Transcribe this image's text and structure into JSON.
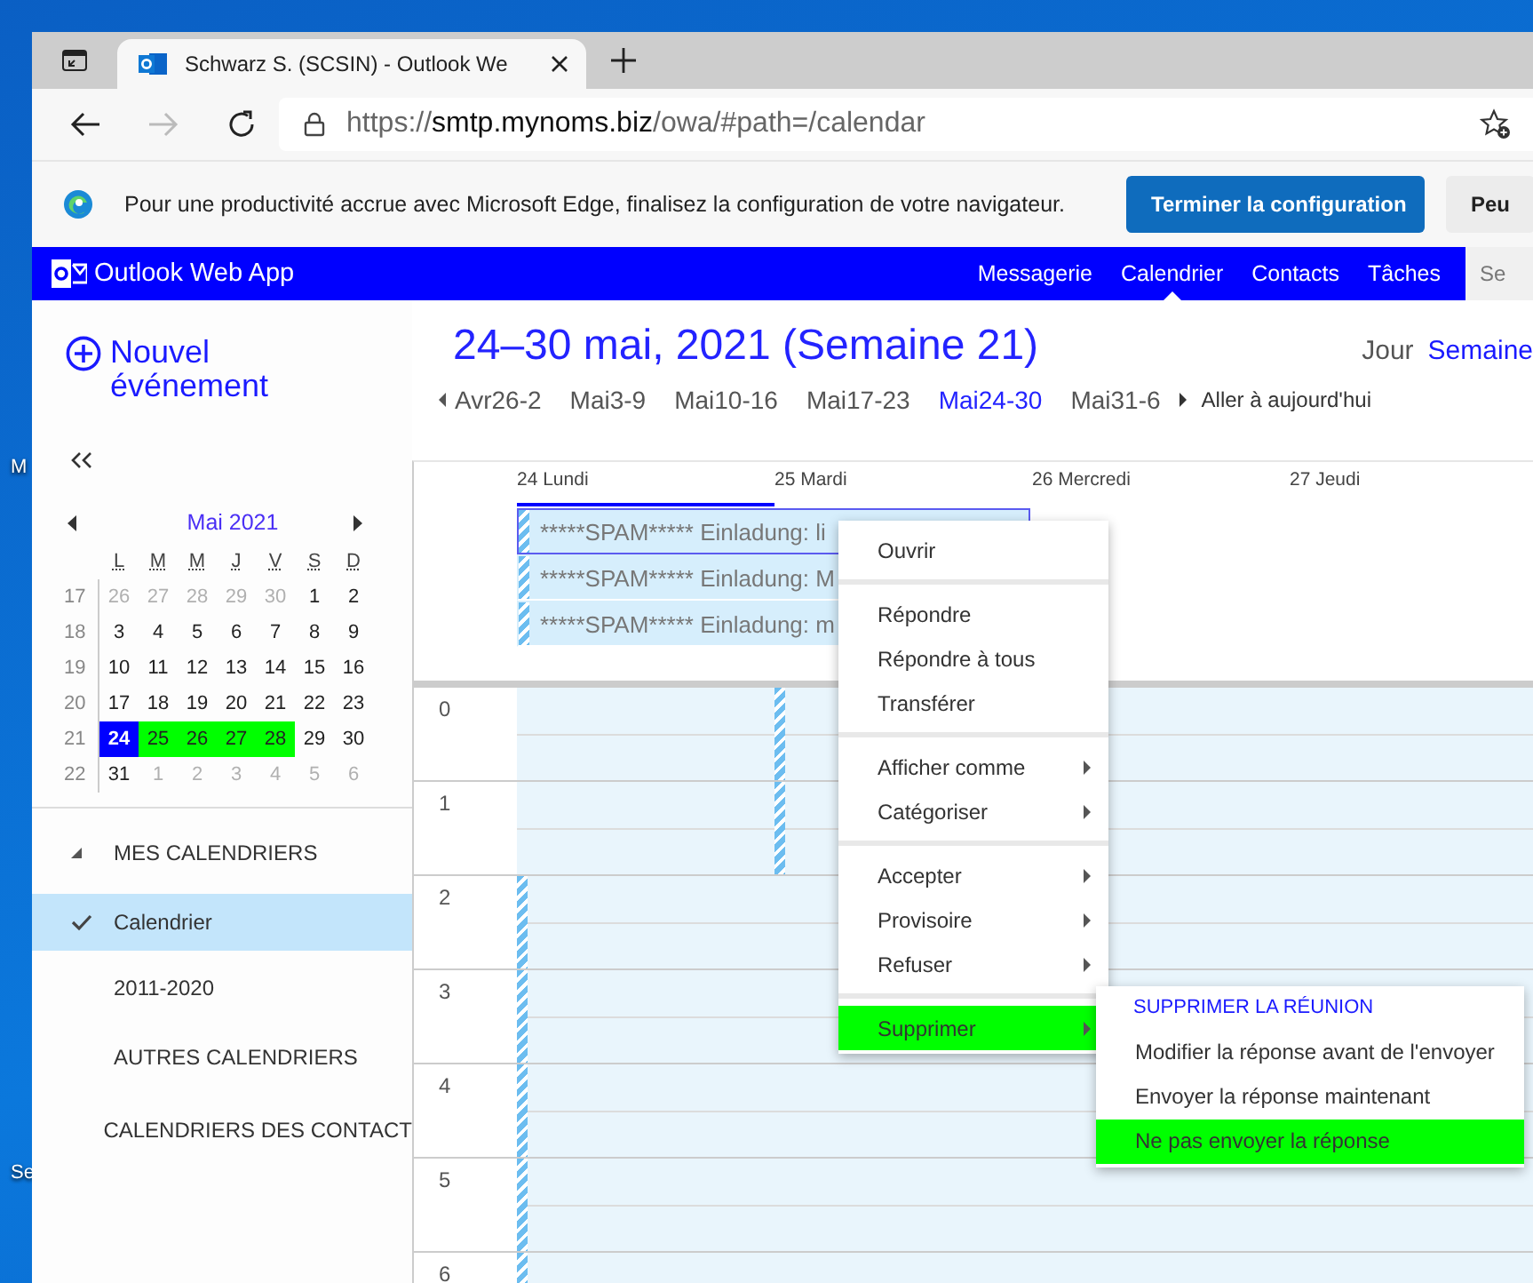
{
  "desktop": {
    "labels": [
      "M",
      "Se"
    ]
  },
  "browser": {
    "tabs": [
      {
        "title": "Schwarz S. (SCSIN) - Outlook We",
        "selected": true
      }
    ],
    "url": {
      "scheme": "https://",
      "host": "smtp.mynoms.biz",
      "path": "/owa/#path=/calendar"
    },
    "infobar": {
      "message": "Pour une productivité accrue avec Microsoft Edge, finalisez la configuration de votre navigateur.",
      "buttons": [
        {
          "label": "Terminer la configuration",
          "kind": "primary"
        },
        {
          "label": "Peu",
          "kind": "secondary"
        }
      ]
    }
  },
  "app": {
    "title": "Outlook Web App",
    "nav": [
      {
        "label": "Messagerie",
        "selected": false
      },
      {
        "label": "Calendrier",
        "selected": true
      },
      {
        "label": "Contacts",
        "selected": false
      },
      {
        "label": "Tâches",
        "selected": false
      }
    ],
    "search": {
      "placeholder": "Se"
    }
  },
  "sidebar": {
    "new_event": "Nouvel événement",
    "mini_calendar": {
      "month": "Mai 2021",
      "weekdays": [
        "L",
        "M",
        "M",
        "J",
        "V",
        "S",
        "D"
      ],
      "weeks": [
        {
          "number": "17",
          "days": [
            {
              "label": "26",
              "outside": true,
              "selected": false,
              "in_week": false
            },
            {
              "label": "27",
              "outside": true,
              "selected": false,
              "in_week": false
            },
            {
              "label": "28",
              "outside": true,
              "selected": false,
              "in_week": false
            },
            {
              "label": "29",
              "outside": true,
              "selected": false,
              "in_week": false
            },
            {
              "label": "30",
              "outside": true,
              "selected": false,
              "in_week": false
            },
            {
              "label": "1",
              "outside": false,
              "selected": false,
              "in_week": false
            },
            {
              "label": "2",
              "outside": false,
              "selected": false,
              "in_week": false
            }
          ]
        },
        {
          "number": "18",
          "days": [
            {
              "label": "3",
              "outside": false,
              "selected": false,
              "in_week": false
            },
            {
              "label": "4",
              "outside": false,
              "selected": false,
              "in_week": false
            },
            {
              "label": "5",
              "outside": false,
              "selected": false,
              "in_week": false
            },
            {
              "label": "6",
              "outside": false,
              "selected": false,
              "in_week": false
            },
            {
              "label": "7",
              "outside": false,
              "selected": false,
              "in_week": false
            },
            {
              "label": "8",
              "outside": false,
              "selected": false,
              "in_week": false
            },
            {
              "label": "9",
              "outside": false,
              "selected": false,
              "in_week": false
            }
          ]
        },
        {
          "number": "19",
          "days": [
            {
              "label": "10",
              "outside": false,
              "selected": false,
              "in_week": false
            },
            {
              "label": "11",
              "outside": false,
              "selected": false,
              "in_week": false
            },
            {
              "label": "12",
              "outside": false,
              "selected": false,
              "in_week": false
            },
            {
              "label": "13",
              "outside": false,
              "selected": false,
              "in_week": false
            },
            {
              "label": "14",
              "outside": false,
              "selected": false,
              "in_week": false
            },
            {
              "label": "15",
              "outside": false,
              "selected": false,
              "in_week": false
            },
            {
              "label": "16",
              "outside": false,
              "selected": false,
              "in_week": false
            }
          ]
        },
        {
          "number": "20",
          "days": [
            {
              "label": "17",
              "outside": false,
              "selected": false,
              "in_week": false
            },
            {
              "label": "18",
              "outside": false,
              "selected": false,
              "in_week": false
            },
            {
              "label": "19",
              "outside": false,
              "selected": false,
              "in_week": false
            },
            {
              "label": "20",
              "outside": false,
              "selected": false,
              "in_week": false
            },
            {
              "label": "21",
              "outside": false,
              "selected": false,
              "in_week": false
            },
            {
              "label": "22",
              "outside": false,
              "selected": false,
              "in_week": false
            },
            {
              "label": "23",
              "outside": false,
              "selected": false,
              "in_week": false
            }
          ]
        },
        {
          "number": "21",
          "days": [
            {
              "label": "24",
              "outside": false,
              "selected": true,
              "in_week": true
            },
            {
              "label": "25",
              "outside": false,
              "selected": false,
              "in_week": true
            },
            {
              "label": "26",
              "outside": false,
              "selected": false,
              "in_week": true
            },
            {
              "label": "27",
              "outside": false,
              "selected": false,
              "in_week": true
            },
            {
              "label": "28",
              "outside": false,
              "selected": false,
              "in_week": true
            },
            {
              "label": "29",
              "outside": false,
              "selected": false,
              "in_week": false
            },
            {
              "label": "30",
              "outside": false,
              "selected": false,
              "in_week": false
            }
          ]
        },
        {
          "number": "22",
          "days": [
            {
              "label": "31",
              "outside": false,
              "selected": false,
              "in_week": false
            },
            {
              "label": "1",
              "outside": true,
              "selected": false,
              "in_week": false
            },
            {
              "label": "2",
              "outside": true,
              "selected": false,
              "in_week": false
            },
            {
              "label": "3",
              "outside": true,
              "selected": false,
              "in_week": false
            },
            {
              "label": "4",
              "outside": true,
              "selected": false,
              "in_week": false
            },
            {
              "label": "5",
              "outside": true,
              "selected": false,
              "in_week": false
            },
            {
              "label": "6",
              "outside": true,
              "selected": false,
              "in_week": false
            }
          ]
        }
      ]
    },
    "calendars": [
      {
        "label": "MES CALENDRIERS",
        "kind": "group",
        "expanded": true,
        "selected": false
      },
      {
        "label": "Calendrier",
        "kind": "calendar",
        "selected": true
      },
      {
        "label": "2011-2020",
        "kind": "calendar",
        "selected": false
      },
      {
        "label": "AUTRES CALENDRIERS",
        "kind": "group",
        "expanded": false,
        "selected": false
      },
      {
        "label": "CALENDRIERS DES CONTACT",
        "kind": "group",
        "expanded": false,
        "selected": false
      }
    ]
  },
  "main": {
    "title": "24–30 mai, 2021 (Semaine 21)",
    "views": [
      {
        "label": "Jour",
        "selected": false
      },
      {
        "label": "Semaine",
        "selected": true
      }
    ],
    "weeks": [
      {
        "label": "Avr26-2",
        "selected": false
      },
      {
        "label": "Mai3-9",
        "selected": false
      },
      {
        "label": "Mai10-16",
        "selected": false
      },
      {
        "label": "Mai17-23",
        "selected": false
      },
      {
        "label": "Mai24-30",
        "selected": true
      },
      {
        "label": "Mai31-6",
        "selected": false
      }
    ],
    "today_link": "Aller à aujourd'hui",
    "days": [
      {
        "label": "24 Lundi",
        "selected": true
      },
      {
        "label": "25 Mardi",
        "selected": false
      },
      {
        "label": "26 Mercredi",
        "selected": false
      },
      {
        "label": "27 Jeudi",
        "selected": false
      }
    ],
    "all_day_events": [
      {
        "title": "*****SPAM***** Einladung: li",
        "selected": true
      },
      {
        "title": "*****SPAM***** Einladung: M",
        "selected": false
      },
      {
        "title": "*****SPAM***** Einladung: m",
        "selected": false
      }
    ],
    "hours": [
      {
        "label": "0",
        "busy": [
          false,
          true,
          false,
          false
        ]
      },
      {
        "label": "1",
        "busy": [
          false,
          true,
          false,
          false
        ]
      },
      {
        "label": "2",
        "busy": [
          true,
          false,
          false,
          false
        ]
      },
      {
        "label": "3",
        "busy": [
          true,
          false,
          false,
          false
        ]
      },
      {
        "label": "4",
        "busy": [
          true,
          false,
          false,
          false
        ]
      },
      {
        "label": "5",
        "busy": [
          true,
          false,
          false,
          false
        ]
      },
      {
        "label": "6",
        "busy": [
          true,
          false,
          false,
          false
        ]
      }
    ]
  },
  "context_menu": {
    "groups": [
      {
        "items": [
          {
            "label": "Ouvrir",
            "submenu": false,
            "selected": false
          }
        ]
      },
      {
        "items": [
          {
            "label": "Répondre",
            "submenu": false,
            "selected": false
          },
          {
            "label": "Répondre à tous",
            "submenu": false,
            "selected": false
          },
          {
            "label": "Transférer",
            "submenu": false,
            "selected": false
          }
        ]
      },
      {
        "items": [
          {
            "label": "Afficher comme",
            "submenu": true,
            "selected": false
          },
          {
            "label": "Catégoriser",
            "submenu": true,
            "selected": false
          }
        ]
      },
      {
        "items": [
          {
            "label": "Accepter",
            "submenu": true,
            "selected": false
          },
          {
            "label": "Provisoire",
            "submenu": true,
            "selected": false
          },
          {
            "label": "Refuser",
            "submenu": true,
            "selected": false
          }
        ]
      },
      {
        "items": [
          {
            "label": "Supprimer",
            "submenu": true,
            "selected": true
          }
        ]
      }
    ]
  },
  "submenu": {
    "heading": "SUPPRIMER LA RÉUNION",
    "items": [
      {
        "label": "Modifier la réponse avant de l'envoyer",
        "selected": false
      },
      {
        "label": "Envoyer la réponse maintenant",
        "selected": false
      },
      {
        "label": "Ne pas envoyer la réponse",
        "selected": true
      }
    ]
  }
}
